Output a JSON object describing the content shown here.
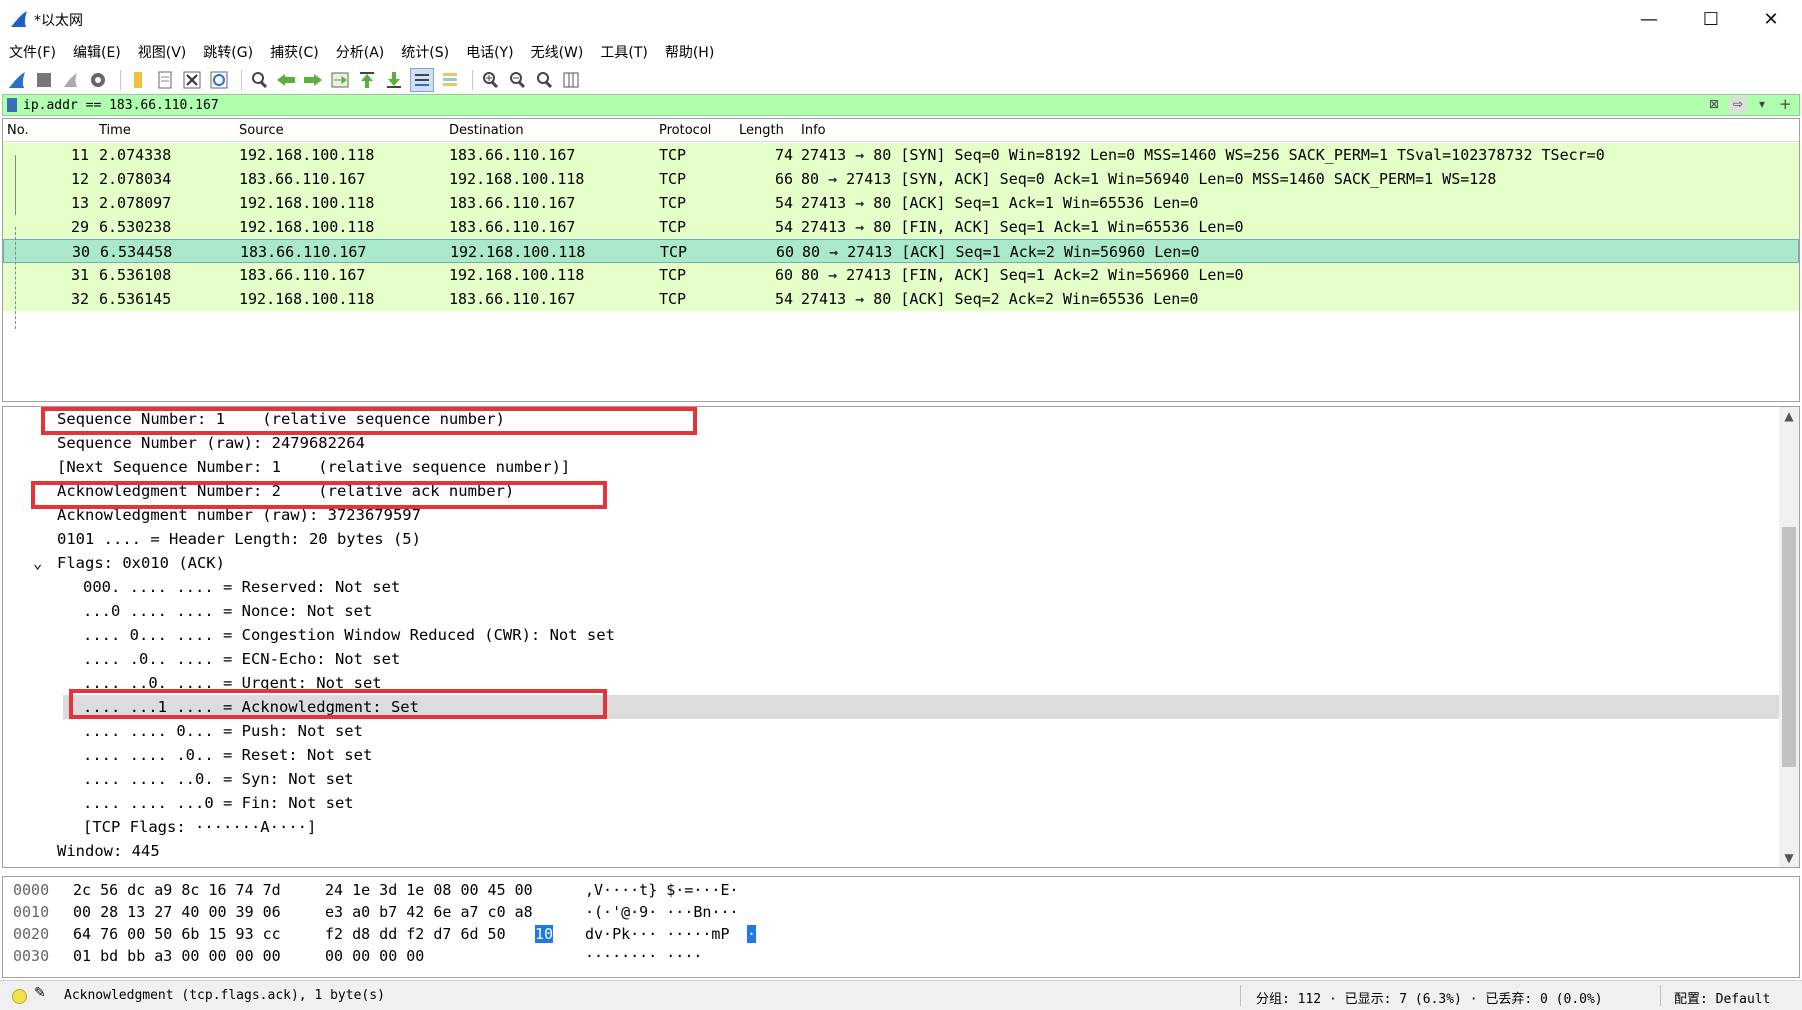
{
  "window": {
    "title": "*以太网",
    "minimize": "—",
    "maximize": "☐",
    "close": "✕"
  },
  "menu": [
    "文件(F)",
    "编辑(E)",
    "视图(V)",
    "跳转(G)",
    "捕获(C)",
    "分析(A)",
    "统计(S)",
    "电话(Y)",
    "无线(W)",
    "工具(T)",
    "帮助(H)"
  ],
  "toolbar_icons": [
    "shark-fin-start-icon",
    "stop-square-icon",
    "restart-icon",
    "options-gear-icon",
    "open-folder-icon",
    "file-icon",
    "close-file-icon",
    "reload-icon",
    "find-magnifier-icon",
    "back-arrow-icon",
    "forward-arrow-icon",
    "goto-packet-icon",
    "first-packet-icon",
    "last-packet-icon",
    "autoscroll-icon",
    "colorize-icon",
    "zoom-in-icon",
    "zoom-out-icon",
    "zoom-normal-icon",
    "resize-columns-icon"
  ],
  "filter": {
    "value": "ip.addr == 183.66.110.167",
    "clear": "⊠",
    "apply": "⇨",
    "dropdown": "▾",
    "add": "+"
  },
  "columns": {
    "no": "No.",
    "time": "Time",
    "source": "Source",
    "destination": "Destination",
    "protocol": "Protocol",
    "length": "Length",
    "info": "Info"
  },
  "packets": [
    {
      "no": "11",
      "time": "2.074338",
      "src": "192.168.100.118",
      "dst": "183.66.110.167",
      "proto": "TCP",
      "len": "74",
      "info": "27413 → 80 [SYN] Seq=0 Win=8192 Len=0 MSS=1460 WS=256 SACK_PERM=1 TSval=102378732 TSecr=0"
    },
    {
      "no": "12",
      "time": "2.078034",
      "src": "183.66.110.167",
      "dst": "192.168.100.118",
      "proto": "TCP",
      "len": "66",
      "info": "80 → 27413 [SYN, ACK] Seq=0 Ack=1 Win=56940 Len=0 MSS=1460 SACK_PERM=1 WS=128"
    },
    {
      "no": "13",
      "time": "2.078097",
      "src": "192.168.100.118",
      "dst": "183.66.110.167",
      "proto": "TCP",
      "len": "54",
      "info": "27413 → 80 [ACK] Seq=1 Ack=1 Win=65536 Len=0"
    },
    {
      "no": "29",
      "time": "6.530238",
      "src": "192.168.100.118",
      "dst": "183.66.110.167",
      "proto": "TCP",
      "len": "54",
      "info": "27413 → 80 [FIN, ACK] Seq=1 Ack=1 Win=65536 Len=0"
    },
    {
      "no": "30",
      "time": "6.534458",
      "src": "183.66.110.167",
      "dst": "192.168.100.118",
      "proto": "TCP",
      "len": "60",
      "info": "80 → 27413 [ACK] Seq=1 Ack=2 Win=56960 Len=0"
    },
    {
      "no": "31",
      "time": "6.536108",
      "src": "183.66.110.167",
      "dst": "192.168.100.118",
      "proto": "TCP",
      "len": "60",
      "info": "80 → 27413 [FIN, ACK] Seq=1 Ack=2 Win=56960 Len=0"
    },
    {
      "no": "32",
      "time": "6.536145",
      "src": "192.168.100.118",
      "dst": "183.66.110.167",
      "proto": "TCP",
      "len": "54",
      "info": "27413 → 80 [ACK] Seq=2 Ack=2 Win=65536 Len=0"
    }
  ],
  "selected_packet_index": 4,
  "details": [
    "Sequence Number: 1    (relative sequence number)",
    "Sequence Number (raw): 2479682264",
    "[Next Sequence Number: 1    (relative sequence number)]",
    "Acknowledgment Number: 2    (relative ack number)",
    "Acknowledgment number (raw): 3723679597",
    "0101 .... = Header Length: 20 bytes (5)",
    "Flags: 0x010 (ACK)",
    "000. .... .... = Reserved: Not set",
    "...0 .... .... = Nonce: Not set",
    ".... 0... .... = Congestion Window Reduced (CWR): Not set",
    ".... .0.. .... = ECN-Echo: Not set",
    ".... ..0. .... = Urgent: Not set",
    ".... ...1 .... = Acknowledgment: Set",
    ".... .... 0... = Push: Not set",
    ".... .... .0.. = Reset: Not set",
    ".... .... ..0. = Syn: Not set",
    ".... .... ...0 = Fin: Not set",
    "[TCP Flags: ·······A····]",
    "Window: 445"
  ],
  "flags_expander": "⌄",
  "hex": [
    {
      "offset": "0000",
      "bytes_a": "2c 56 dc a9 8c 16 74 7d",
      "bytes_b": "24 1e 3d 1e 08 00 45 00",
      "ascii": ",V····t} $·=···E·"
    },
    {
      "offset": "0010",
      "bytes_a": "00 28 13 27 40 00 39 06",
      "bytes_b": "e3 a0 b7 42 6e a7 c0 a8",
      "ascii": "·(·'@·9· ···Bn···"
    },
    {
      "offset": "0020",
      "bytes_a": "64 76 00 50 6b 15 93 cc",
      "bytes_b": "f2 d8 dd f2 d7 6d 50",
      "sel_byte": "10",
      "ascii": "dv·Pk··· ·····mP",
      "ascii_sel": "·"
    },
    {
      "offset": "0030",
      "bytes_a": "01 bd bb a3 00 00 00 00",
      "bytes_b": "00 00 00 00",
      "ascii": "········ ····"
    }
  ],
  "status": {
    "field": "Acknowledgment (tcp.flags.ack), 1 byte(s)",
    "packets": "分组: 112 · 已显示: 7 (6.3%) · 已丢弃: 0 (0.0%)",
    "profile": "配置: Default"
  }
}
